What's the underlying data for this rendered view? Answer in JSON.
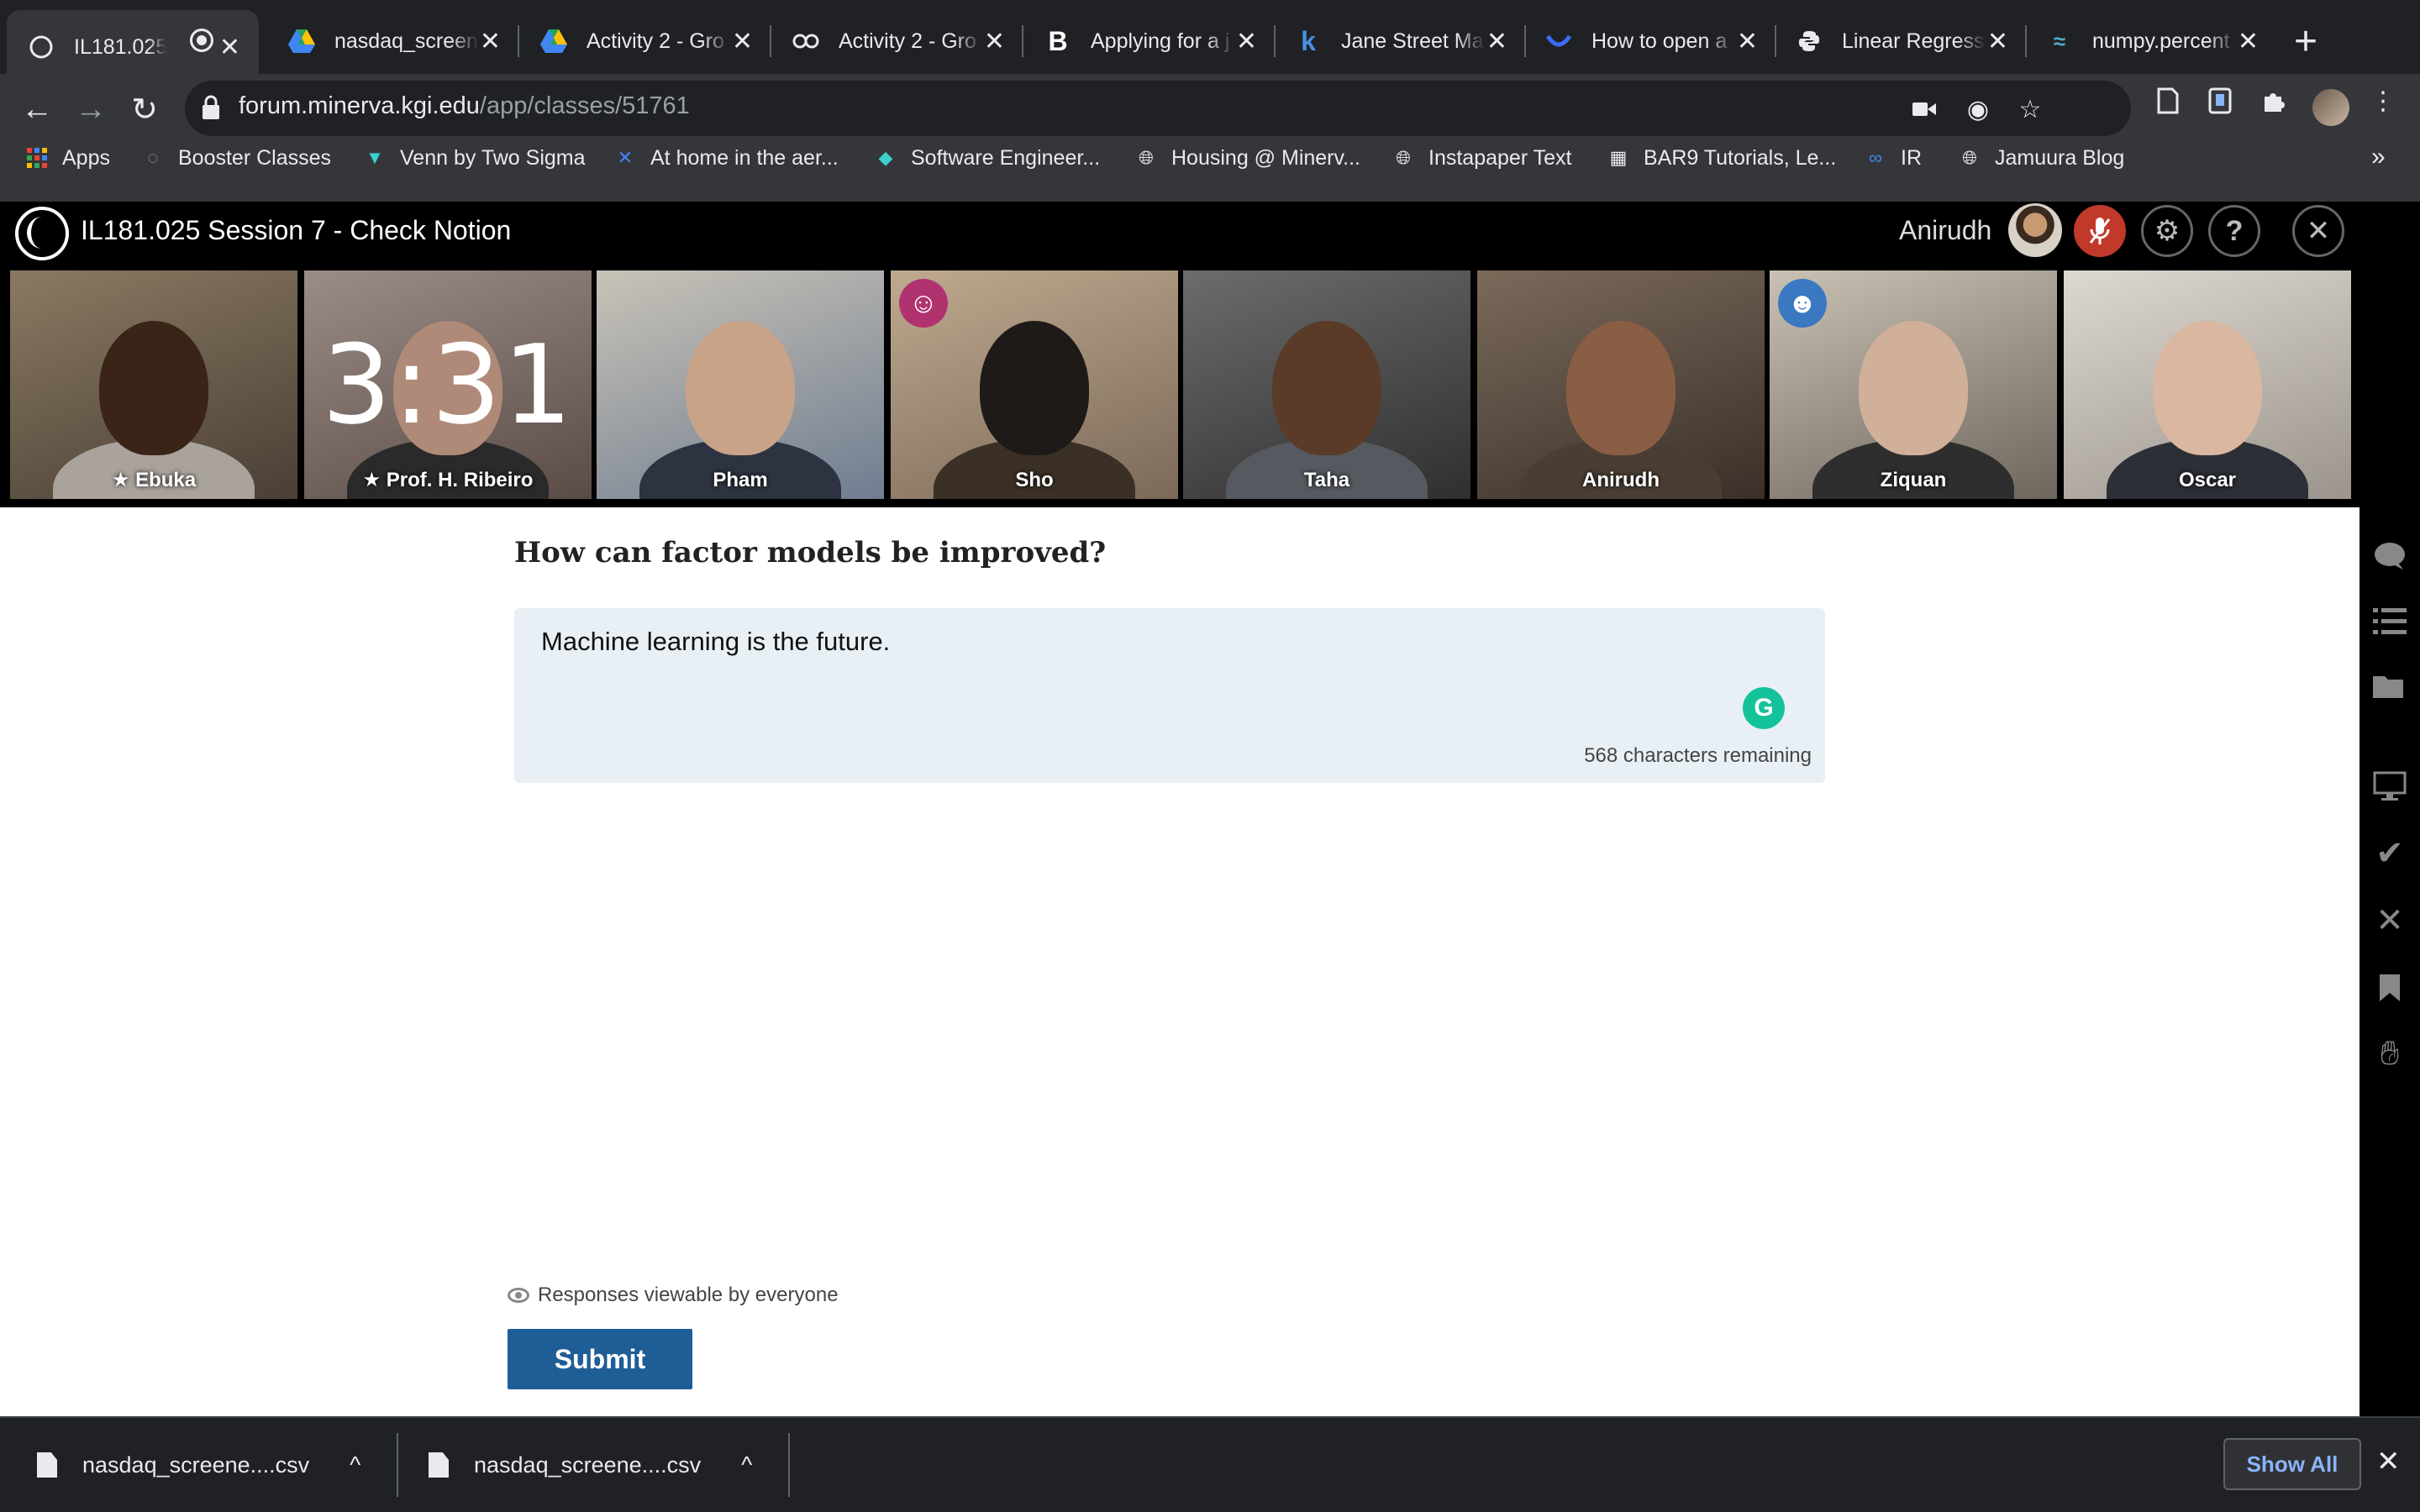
{
  "browser": {
    "tabs": [
      {
        "title": "IL181.025 S",
        "icon": "minerva-icon"
      },
      {
        "title": "nasdaq_screen",
        "icon": "google-drive-icon"
      },
      {
        "title": "Activity 2 - Gro",
        "icon": "google-drive-icon"
      },
      {
        "title": "Activity 2 - Gro",
        "icon": "colab-icon"
      },
      {
        "title": "Applying for a j",
        "icon": "b-logo-icon"
      },
      {
        "title": "Jane Street Ma",
        "icon": "k-logo-icon"
      },
      {
        "title": "How to open a",
        "icon": "smile-logo-icon"
      },
      {
        "title": "Linear Regress",
        "icon": "python-icon"
      },
      {
        "title": "numpy.percent",
        "icon": "numpy-icon"
      }
    ],
    "url_host": "forum.minerva.kgi.edu",
    "url_path": "/app/classes/51761",
    "bookmarks": [
      {
        "label": "Apps",
        "icon": "apps-grid-icon"
      },
      {
        "label": "Booster Classes",
        "icon": "booster-icon"
      },
      {
        "label": "Venn by Two Sigma",
        "icon": "venn-icon"
      },
      {
        "label": "At home in the aer...",
        "icon": "bookmark-site-icon"
      },
      {
        "label": "Software Engineer...",
        "icon": "bookmark-site-icon"
      },
      {
        "label": "Housing @ Minerv...",
        "icon": "globe-icon"
      },
      {
        "label": "Instapaper Text",
        "icon": "globe-icon"
      },
      {
        "label": "BAR9 Tutorials, Le...",
        "icon": "calendar-icon"
      },
      {
        "label": "IR",
        "icon": "bookmark-site-icon"
      },
      {
        "label": "Jamuura Blog",
        "icon": "globe-icon"
      }
    ],
    "more_bookmarks": "»"
  },
  "app": {
    "session_title": "IL181.025 Session 7 - Check Notion",
    "user_name": "Anirudh"
  },
  "participants": [
    {
      "name": "Ebuka",
      "starred": true
    },
    {
      "name": "Prof. H. Ribeiro",
      "starred": true,
      "timer": "3:31"
    },
    {
      "name": "Pham",
      "starred": false
    },
    {
      "name": "Sho",
      "starred": false,
      "reaction": "laughing-emoji-icon"
    },
    {
      "name": "Taha",
      "starred": false
    },
    {
      "name": "Anirudh",
      "starred": false
    },
    {
      "name": "Ziquan",
      "starred": false,
      "reaction": "robot-face-icon"
    },
    {
      "name": "Oscar",
      "starred": false
    }
  ],
  "poll": {
    "question": "How can factor models be improved?",
    "answer": "Machine learning is the future.",
    "chars_remaining": "568 characters remaining",
    "visibility_note": "Responses viewable by everyone",
    "submit_label": "Submit"
  },
  "downloads": {
    "items": [
      {
        "filename": "nasdaq_screene....csv"
      },
      {
        "filename": "nasdaq_screene....csv"
      }
    ],
    "show_all_label": "Show All"
  }
}
